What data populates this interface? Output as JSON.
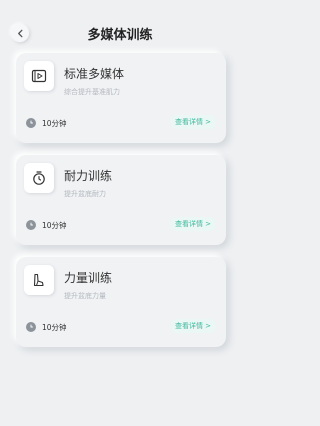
{
  "header": {
    "title": "多媒体训练"
  },
  "cards": [
    {
      "title": "标准多媒体",
      "subtitle": "综合提升基准肌力",
      "duration": "10分钟",
      "detail": "查看详情 >",
      "icon": "video-icon"
    },
    {
      "title": "耐力训练",
      "subtitle": "提升盆底耐力",
      "duration": "10分钟",
      "detail": "查看详情 >",
      "icon": "timer-icon"
    },
    {
      "title": "力量训练",
      "subtitle": "提升盆底力量",
      "duration": "10分钟",
      "detail": "查看详情 >",
      "icon": "strength-icon"
    }
  ],
  "colors": {
    "accent": "#41b89e",
    "background": "#eef0f2"
  }
}
